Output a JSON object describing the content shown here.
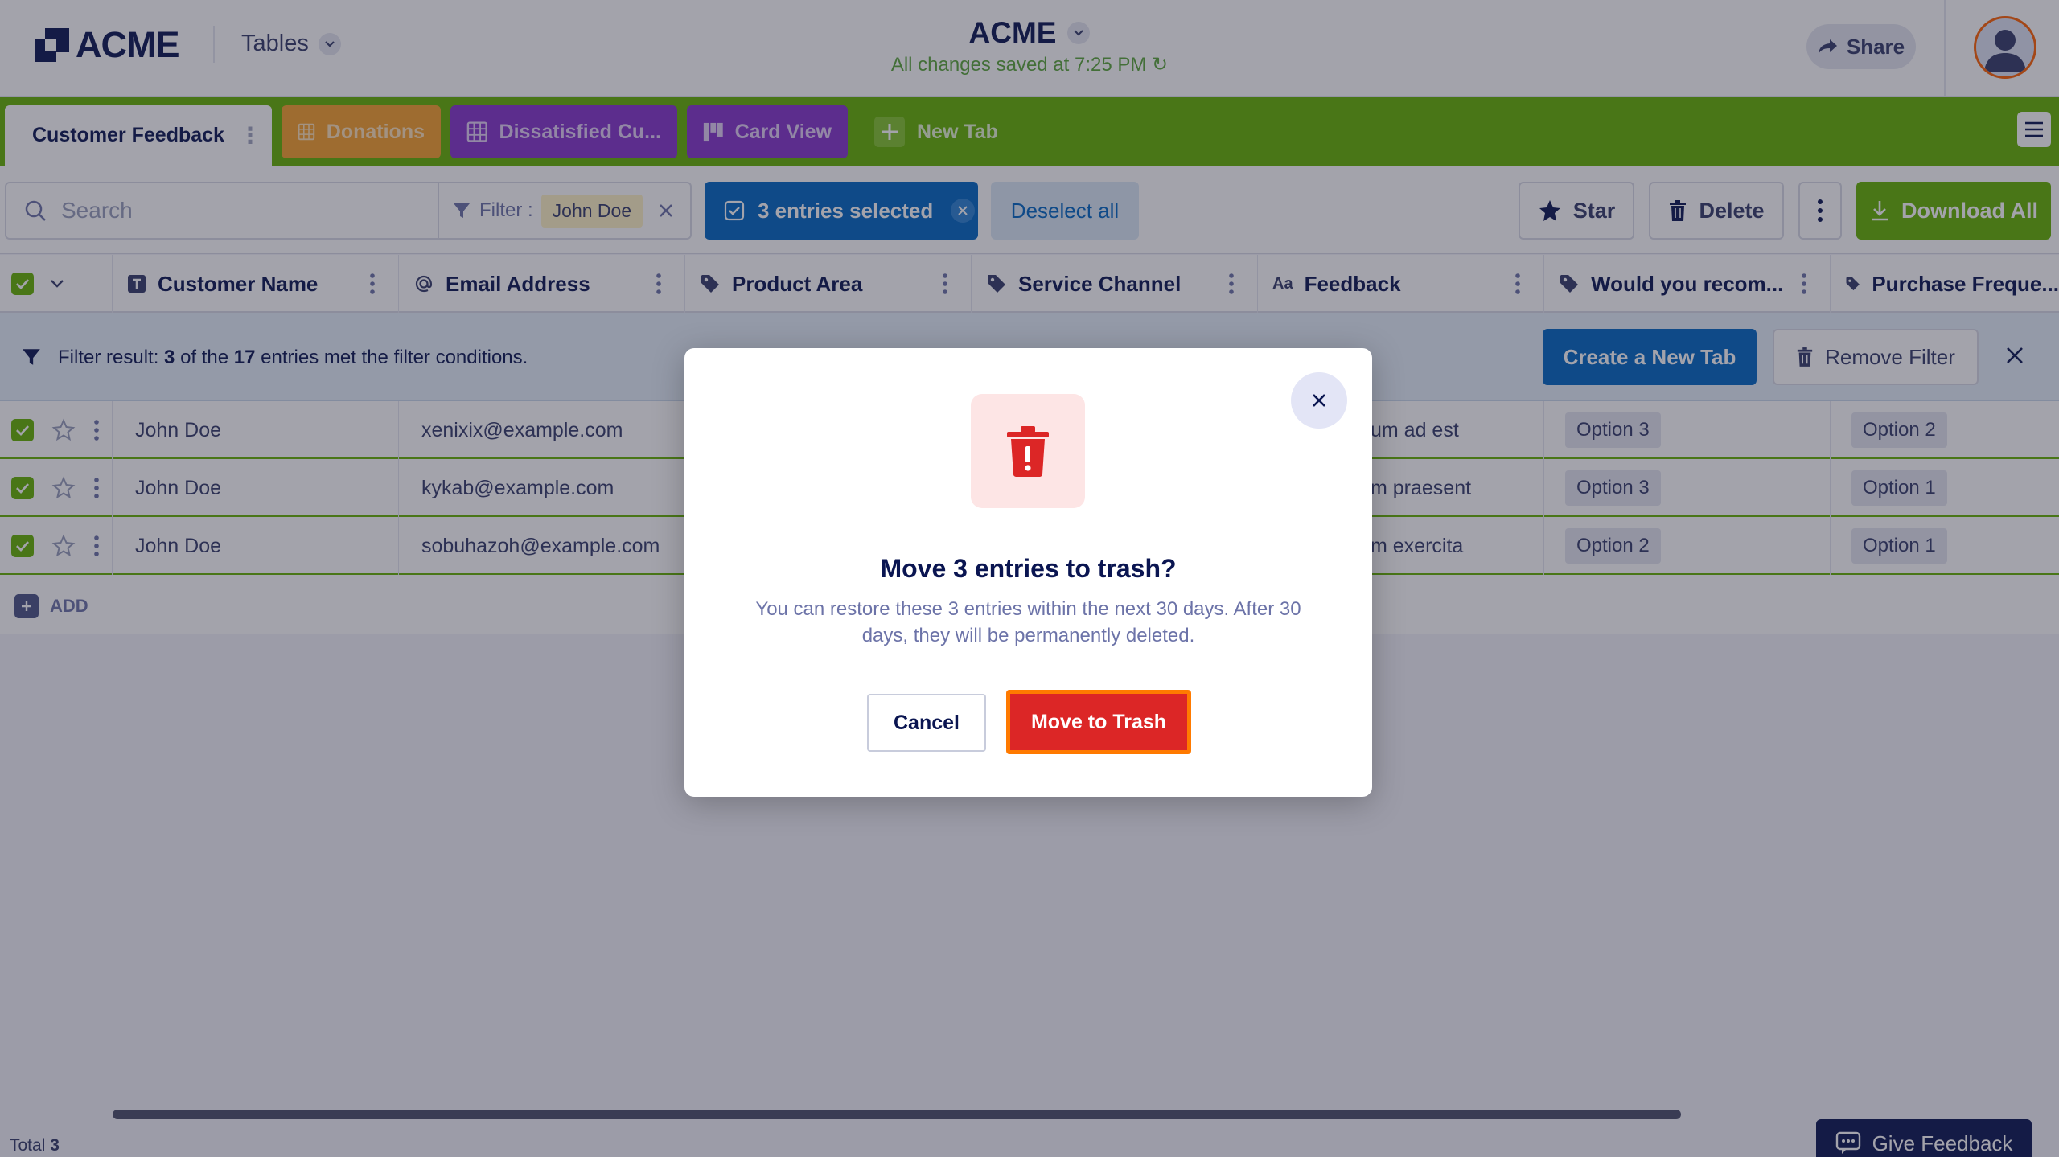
{
  "header": {
    "logo_text": "ACME",
    "tables_label": "Tables",
    "doc_title": "ACME",
    "saved_status": "All changes saved at 7:25 PM",
    "share_label": "Share"
  },
  "tabs": [
    {
      "label": "Customer Feedback",
      "active": true,
      "color": "#ffffff"
    },
    {
      "label": "Donations",
      "active": false,
      "color": "#f7a12b"
    },
    {
      "label": "Dissatisfied Cu...",
      "active": false,
      "color": "#8535cc"
    },
    {
      "label": "Card View",
      "active": false,
      "color": "#8535cc"
    }
  ],
  "new_tab_label": "New Tab",
  "toolbar": {
    "search_placeholder": "Search",
    "filter_label": "Filter :",
    "filter_value": "John Doe",
    "selected_label": "3 entries selected",
    "deselect_label": "Deselect all",
    "star_label": "Star",
    "delete_label": "Delete",
    "download_label": "Download All"
  },
  "columns": [
    {
      "label": "Customer Name",
      "icon": "text-type-icon"
    },
    {
      "label": "Email Address",
      "icon": "at-sign-icon"
    },
    {
      "label": "Product Area",
      "icon": "tag-icon"
    },
    {
      "label": "Service Channel",
      "icon": "tag-icon"
    },
    {
      "label": "Feedback",
      "icon": "text-aa-icon"
    },
    {
      "label": "Would you recom...",
      "icon": "tag-icon"
    },
    {
      "label": "Purchase Freque...",
      "icon": "tag-icon"
    }
  ],
  "filter_banner": {
    "prefix": "Filter result:",
    "count": "3",
    "middle": "of the",
    "total": "17",
    "suffix": "entries met the filter conditions.",
    "create_tab_label": "Create a New Tab",
    "remove_filter_label": "Remove Filter"
  },
  "rows": [
    {
      "name": "John Doe",
      "email": "xenixix@example.com",
      "feedback": "um ad est",
      "recommend": "Option 3",
      "frequency": "Option 2"
    },
    {
      "name": "John Doe",
      "email": "kykab@example.com",
      "feedback": "m praesent",
      "recommend": "Option 3",
      "frequency": "Option 1"
    },
    {
      "name": "John Doe",
      "email": "sobuhazoh@example.com",
      "feedback": "m exercita",
      "recommend": "Option 2",
      "frequency": "Option 1"
    }
  ],
  "add_label": "ADD",
  "footer": {
    "total_label": "Total",
    "total_value": "3",
    "give_feedback_label": "Give Feedback"
  },
  "modal": {
    "title": "Move 3 entries to trash?",
    "message": "You can restore these 3 entries within the next 30 days. After 30 days, they will be permanently deleted.",
    "cancel_label": "Cancel",
    "confirm_label": "Move to Trash"
  },
  "colors": {
    "brand_navy": "#0a1551",
    "tab_green": "#64b200",
    "primary_blue": "#0066c3",
    "danger_red": "#dc2626",
    "focus_orange": "#ff7a00"
  }
}
